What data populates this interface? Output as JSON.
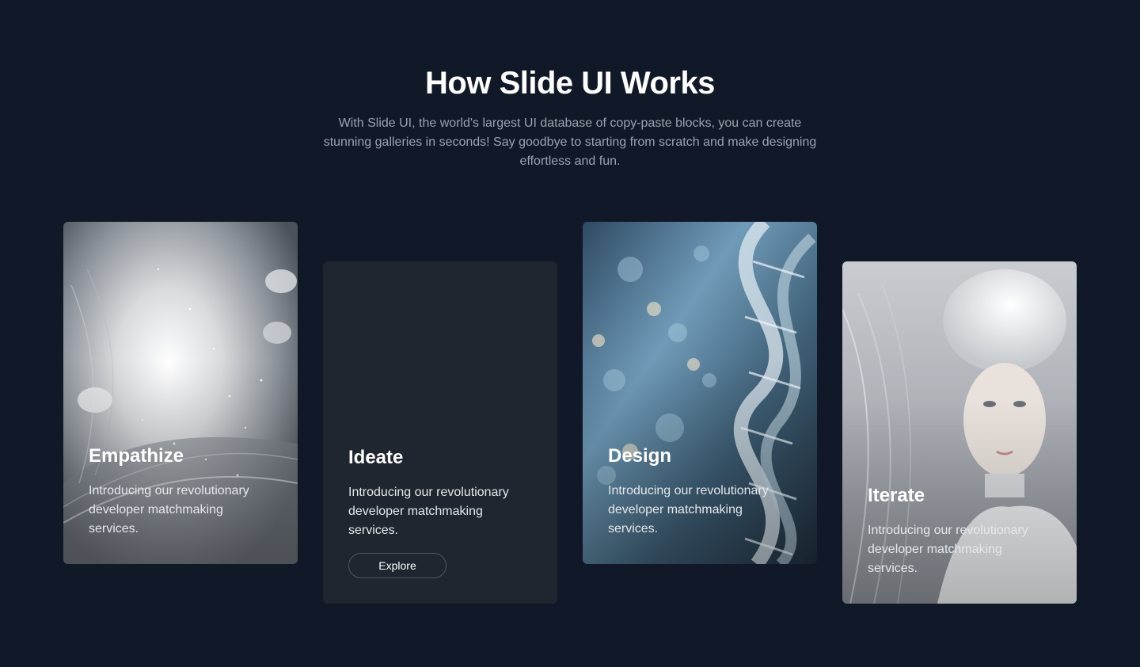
{
  "section": {
    "title": "How Slide UI Works",
    "subtitle": "With Slide UI, the world's largest UI database of copy-paste blocks, you can create stunning galleries in seconds! Say goodbye to starting from scratch and make designing effortless and fun."
  },
  "cards": [
    {
      "title": "Empathize",
      "description": "Introducing our revolutionary developer matchmaking services.",
      "image": "silver-tech-tunnel-image"
    },
    {
      "title": "Ideate",
      "description": "Introducing our revolutionary developer matchmaking services.",
      "button_label": "Explore"
    },
    {
      "title": "Design",
      "description": "Introducing our revolutionary developer matchmaking services.",
      "image": "glass-dna-helix-image"
    },
    {
      "title": "Iterate",
      "description": "Introducing our revolutionary developer matchmaking services.",
      "image": "white-android-portrait-image"
    }
  ],
  "colors": {
    "background": "#111827",
    "card_dark": "#1f2630",
    "subtitle_text": "#9ca3af",
    "button_border": "#4b5563"
  }
}
